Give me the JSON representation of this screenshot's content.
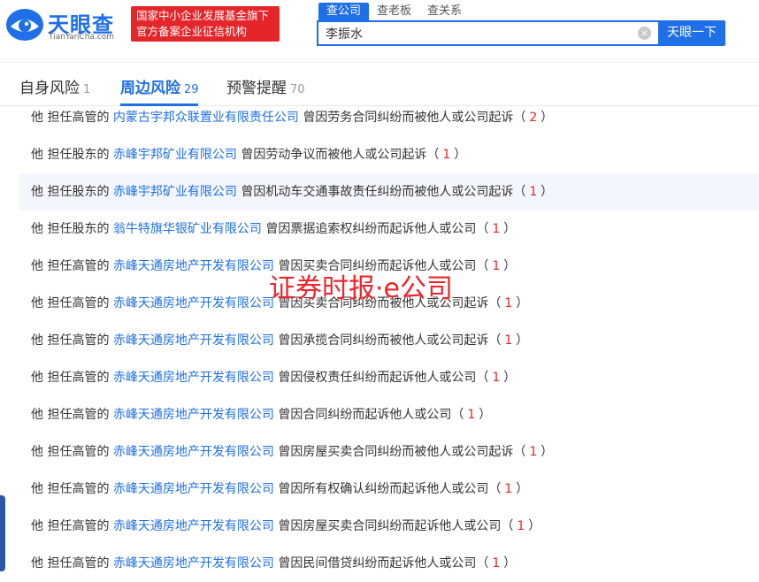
{
  "brand": {
    "name_cn": "天眼查",
    "name_en": "TianYanCha.com",
    "badge_line1": "国家中小企业发展基金旗下",
    "badge_line2": "官方备案企业征信机构"
  },
  "search": {
    "tabs": [
      {
        "label": "查公司",
        "active": true
      },
      {
        "label": "查老板",
        "active": false
      },
      {
        "label": "查关系",
        "active": false
      }
    ],
    "value": "李振水",
    "button_label": "天眼一下",
    "clear_icon": "×"
  },
  "risk_tabs": [
    {
      "label": "自身风险",
      "count": "1",
      "active": false
    },
    {
      "label": "周边风险",
      "count": "29",
      "active": true
    },
    {
      "label": "预警提醒",
      "count": "70",
      "active": false
    }
  ],
  "rows": [
    {
      "prefix": "他 担任高管的",
      "company": "内蒙古宇邦众联置业有限责任公司",
      "desc": "曾因劳务合同纠纷而被他人或公司起诉",
      "count": "2"
    },
    {
      "prefix": "他 担任股东的",
      "company": "赤峰宇邦矿业有限公司",
      "desc": "曾因劳动争议而被他人或公司起诉",
      "count": "1"
    },
    {
      "prefix": "他 担任股东的",
      "company": "赤峰宇邦矿业有限公司",
      "desc": "曾因机动车交通事故责任纠纷而被他人或公司起诉",
      "count": "1"
    },
    {
      "prefix": "他 担任股东的",
      "company": "翁牛特旗华银矿业有限公司",
      "desc": "曾因票据追索权纠纷而起诉他人或公司",
      "count": "1"
    },
    {
      "prefix": "他 担任高管的",
      "company": "赤峰天通房地产开发有限公司",
      "desc": "曾因买卖合同纠纷而起诉他人或公司",
      "count": "1"
    },
    {
      "prefix": "他 担任高管的",
      "company": "赤峰天通房地产开发有限公司",
      "desc": "曾因买卖合同纠纷而被他人或公司起诉",
      "count": "1"
    },
    {
      "prefix": "他 担任高管的",
      "company": "赤峰天通房地产开发有限公司",
      "desc": "曾因承揽合同纠纷而被他人或公司起诉",
      "count": "1"
    },
    {
      "prefix": "他 担任高管的",
      "company": "赤峰天通房地产开发有限公司",
      "desc": "曾因侵权责任纠纷而起诉他人或公司",
      "count": "1"
    },
    {
      "prefix": "他 担任高管的",
      "company": "赤峰天通房地产开发有限公司",
      "desc": "曾因合同纠纷而起诉他人或公司",
      "count": "1"
    },
    {
      "prefix": "他 担任高管的",
      "company": "赤峰天通房地产开发有限公司",
      "desc": "曾因房屋买卖合同纠纷而被他人或公司起诉",
      "count": "1"
    },
    {
      "prefix": "他 担任高管的",
      "company": "赤峰天通房地产开发有限公司",
      "desc": "曾因所有权确认纠纷而起诉他人或公司",
      "count": "1"
    },
    {
      "prefix": "他 担任高管的",
      "company": "赤峰天通房地产开发有限公司",
      "desc": "曾因房屋买卖合同纠纷而起诉他人或公司",
      "count": "1"
    },
    {
      "prefix": "他 担任高管的",
      "company": "赤峰天通房地产开发有限公司",
      "desc": "曾因民间借贷纠纷而起诉他人或公司",
      "count": "1"
    }
  ],
  "watermark": "证券时报·e公司",
  "colors": {
    "accent": "#1e6fe8",
    "badge_red": "#e4262b",
    "watermark": "#f0242b",
    "highlight_row": "#f3f7fd"
  }
}
